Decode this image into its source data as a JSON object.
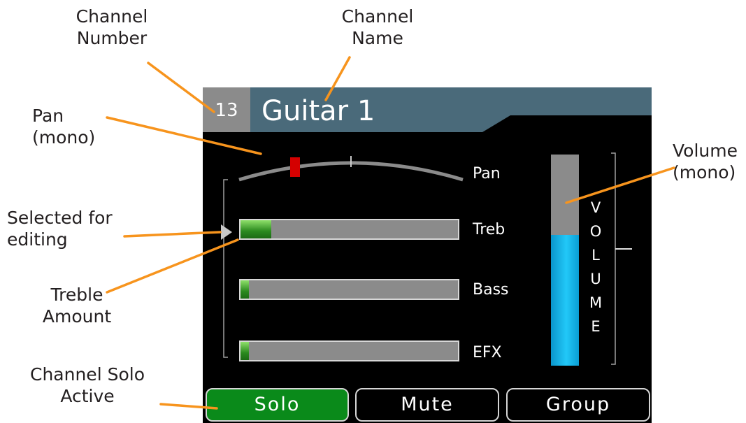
{
  "annotations": {
    "channel_number": "Channel\nNumber",
    "channel_name": "Channel\nName",
    "pan": "Pan\n(mono)",
    "selected": "Selected for\nediting",
    "treble": "Treble\nAmount",
    "solo_active": "Channel Solo\nActive",
    "volume": "Volume\n(mono)"
  },
  "colors": {
    "callout_line": "#f7941d",
    "header_bar": "#4a6a7a",
    "solo_active": "#0a8a1a",
    "pan_marker": "#d40000"
  },
  "channel": {
    "number": "13",
    "name": "Guitar 1"
  },
  "pan": {
    "label": "Pan",
    "position": -0.5
  },
  "controls": {
    "selected_index": 0,
    "selection_icon": "right-triangle-arrow-icon",
    "items": [
      {
        "key": "treble",
        "label": "Treb",
        "level_fraction": 0.14
      },
      {
        "key": "bass",
        "label": "Bass",
        "level_fraction": 0.04
      },
      {
        "key": "efx",
        "label": "EFX",
        "level_fraction": 0.04
      }
    ]
  },
  "volume": {
    "letters": [
      "V",
      "O",
      "L",
      "U",
      "M",
      "E"
    ],
    "level_fraction": 0.62
  },
  "buttons": {
    "solo": "Solo",
    "mute": "Mute",
    "group": "Group",
    "solo_active": true
  }
}
